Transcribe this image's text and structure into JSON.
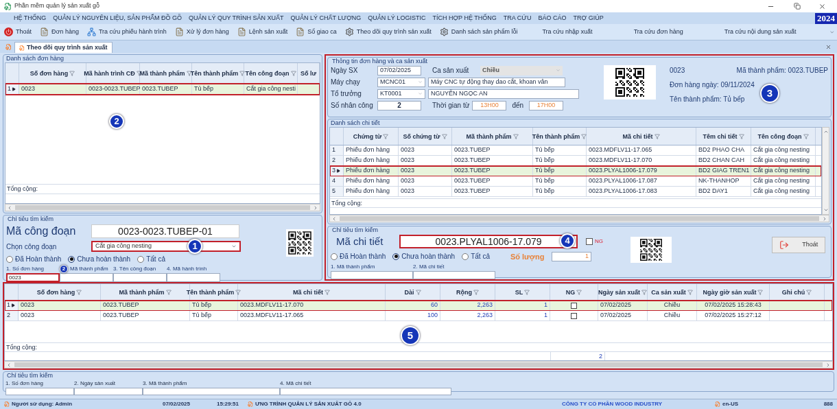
{
  "window": {
    "title": "Phần mềm quản lý sản xuất gỗ"
  },
  "menu": [
    "HỆ THỐNG",
    "QUẢN LÝ NGUYÊN LIỆU, SẢN PHẨM ĐỒ GỖ",
    "QUẢN LÝ QUY TRÌNH SẢN XUẤT",
    "QUẢN LÝ CHẤT LƯỢNG",
    "QUẢN LÝ LOGISTIC",
    "TÍCH HỢP HỆ THỐNG",
    "TRA CỨU",
    "BÁO CÁO",
    "TRỢ GIÚP"
  ],
  "year": "2024",
  "toolbar": [
    {
      "label": "Thoát",
      "kind": "power"
    },
    {
      "label": "Đơn hàng",
      "kind": "doc"
    },
    {
      "label": "Tra cứu phiếu hành trình",
      "kind": "network"
    },
    {
      "label": "Xử lý đơn hàng",
      "kind": "doc"
    },
    {
      "label": "Lệnh sản xuất",
      "kind": "doc"
    },
    {
      "label": "Sổ giao ca",
      "kind": "doc"
    },
    {
      "label": "Theo dõi quy trình sản xuất",
      "kind": "gear"
    },
    {
      "label": "Danh sách sản phẩm lỗi",
      "kind": "gear"
    },
    {
      "label": "Tra cứu nhập xuất",
      "kind": "text"
    },
    {
      "label": "Tra cứu đơn hàng",
      "kind": "text"
    },
    {
      "label": "Tra cứu nội dung sản xuất",
      "kind": "text"
    }
  ],
  "tabs": [
    {
      "label": "Theo dõi quy trình sản xuất",
      "selected": true
    }
  ],
  "orders": {
    "title": "Danh sách đơn hàng",
    "columns": [
      "Số đơn hàng",
      "Mã hành trình CĐ",
      "Mã thành phẩm",
      "Tên thành phẩm",
      "Tên công đoạn",
      "Số lư"
    ],
    "rows": [
      {
        "index": "1",
        "selected": true,
        "cells": [
          "0023",
          "0023-0023.TUBEP",
          "0023.TUBEP",
          "Tủ bếp",
          "Cắt gia công nesti"
        ]
      }
    ],
    "total_label": "Tổng cộng:",
    "callout": "2"
  },
  "stage_search": {
    "title": "Chỉ tiêu tìm kiếm",
    "code_label": "Mã công đoạn",
    "code_value": "0023-0023.TUBEP-01",
    "stage_label": "Chọn công đoạn",
    "stage_value": "Cắt gia công nesting",
    "stage_callout": "1",
    "radios": [
      {
        "label": "Đã Hoàn thành",
        "selected": false
      },
      {
        "label": "Chưa hoàn thành",
        "selected": true
      },
      {
        "label": "Tất cả",
        "selected": false
      }
    ],
    "filters": [
      {
        "label": "1. Số đơn hàng",
        "value": "0023"
      },
      {
        "label": "Mã thành phẩm"
      },
      {
        "label": "3. Tên công đoạn"
      },
      {
        "label": "4. Mã hành trình"
      }
    ],
    "filter_callout": "2"
  },
  "info": {
    "title": "Thông tin đơn hàng và ca sản xuất",
    "date": {
      "label": "Ngày SX",
      "value": "07/02/2025"
    },
    "shift": {
      "label": "Ca sản xuất",
      "value": "Chiều",
      "disabled": true
    },
    "machine": {
      "label": "Máy chạy",
      "code": "MCNC01",
      "name": "Máy CNC tự động thay dao cắt, khoan vân"
    },
    "leader": {
      "label": "Tổ trưởng",
      "code": "KT0001",
      "name": "NGUYỄN NGỌC AN"
    },
    "workers": {
      "label": "Số nhân công",
      "value": "2"
    },
    "time": {
      "label": "Thời gian từ",
      "from": "13H00",
      "to_label": "đến",
      "to": "17H00"
    },
    "order_no": "0023",
    "product_code": "Mã thành phẩm: 0023.TUBEP",
    "order_date": "Đơn hàng ngày: 09/11/2024",
    "product_name": "Tên thành phẩm: Tủ bếp",
    "callout": "3"
  },
  "details": {
    "title": "Danh sách chi tiết",
    "columns": [
      "Chứng từ",
      "Số chứng từ",
      "Mã thành phẩm",
      "Tên thành phẩm",
      "Mã chi tiết",
      "Têm chi tiết",
      "Tên công đoạn"
    ],
    "rows": [
      {
        "index": "1",
        "selected": false,
        "cells": [
          "Phiếu đơn hàng",
          "0023",
          "0023.TUBEP",
          "Tủ bếp",
          "0023.MDFLV11-17.065",
          "BD2 PHAO CHA",
          "Cắt gia công nesting"
        ]
      },
      {
        "index": "2",
        "selected": false,
        "cells": [
          "Phiếu đơn hàng",
          "0023",
          "0023.TUBEP",
          "Tủ bếp",
          "0023.MDFLV11-17.070",
          "BD2 CHAN CAH",
          "Cắt gia công nesting"
        ]
      },
      {
        "index": "3",
        "selected": true,
        "cells": [
          "Phiếu đơn hàng",
          "0023",
          "0023.TUBEP",
          "Tủ bếp",
          "0023.PLYAL1006-17.079",
          "BD2 GIAG TREN1",
          "Cắt gia công nesting"
        ]
      },
      {
        "index": "4",
        "selected": false,
        "cells": [
          "Phiếu đơn hàng",
          "0023",
          "0023.TUBEP",
          "Tủ bếp",
          "0023.PLYAL1006-17.087",
          "NK-THANHOP",
          "Cắt gia công nesting"
        ]
      },
      {
        "index": "5",
        "selected": false,
        "cells": [
          "Phiếu đơn hàng",
          "0023",
          "0023.TUBEP",
          "Tủ bếp",
          "0023.PLYAL1006-17.083",
          "BD2 DAY1",
          "Cắt gia công nesting"
        ]
      }
    ],
    "total_label": "Tổng cộng:"
  },
  "detail_search": {
    "title": "Chỉ tiêu tìm kiếm",
    "code_label": "Mã chi tiết",
    "code_value": "0023.PLYAL1006-17.079",
    "callout": "4",
    "ng": {
      "label": "NG",
      "checked": false
    },
    "radios": [
      {
        "label": "Đã Hoàn thành",
        "selected": false
      },
      {
        "label": "Chưa hoàn thành",
        "selected": true
      },
      {
        "label": "Tất cả",
        "selected": false
      }
    ],
    "qty_label": "Số lượng",
    "qty_value": "1",
    "filters": [
      "1. Mã thành phẩm",
      "2. Mã chi tiết"
    ],
    "exit": "Thoát"
  },
  "produced": {
    "columns": [
      {
        "label": "Số đơn hàng",
        "kind": "text"
      },
      {
        "label": "Mã thành phẩm",
        "kind": "text"
      },
      {
        "label": "Tên thành phẩm",
        "kind": "text"
      },
      {
        "label": "Mã chi tiết",
        "kind": "text"
      },
      {
        "label": "Dài",
        "kind": "number"
      },
      {
        "label": "Rộng",
        "kind": "number"
      },
      {
        "label": "SL",
        "kind": "number"
      },
      {
        "label": "NG",
        "kind": "check"
      },
      {
        "label": "Ngày sản xuất",
        "kind": "text"
      },
      {
        "label": "Ca sản xuất",
        "kind": "center"
      },
      {
        "label": "Ngày giờ sản xuất",
        "kind": "center"
      },
      {
        "label": "Ghi chú",
        "kind": "text"
      }
    ],
    "rows": [
      {
        "index": "1",
        "selected": true,
        "cells": [
          "0023",
          "0023.TUBEP",
          "Tủ bếp",
          "0023.MDFLV11-17.070",
          "60",
          "2,263",
          "1",
          false,
          "07/02/2025",
          "Chiều",
          "07/02/2025 15:28:43",
          ""
        ]
      },
      {
        "index": "2",
        "selected": false,
        "cells": [
          "0023",
          "0023.TUBEP",
          "Tủ bếp",
          "0023.MDFLV11-17.065",
          "100",
          "2,263",
          "1",
          false,
          "07/02/2025",
          "Chiều",
          "07/02/2025 15:27:12",
          ""
        ]
      }
    ],
    "total_label": "Tổng cộng:",
    "sl_total": "2",
    "callout": "5"
  },
  "bottom_search": {
    "title": "Chỉ tiêu tìm kiếm",
    "filters": [
      "1. Số đơn hàng",
      "2. Ngày sản xuất",
      "3. Mã thành phẩm",
      "4. Mã chi tiết"
    ]
  },
  "status_bar": {
    "user": "Người sử dụng: Admin",
    "date": "07/02/2025",
    "time": "15:29:51",
    "program": "ƯNG TRÌNH QUẢN LÝ SẢN XUẤT GỖ 4.0",
    "company": "CÔNG TY CỔ PHẦN WOOD INDUSTRY",
    "locale": "en-US",
    "code": "888"
  }
}
